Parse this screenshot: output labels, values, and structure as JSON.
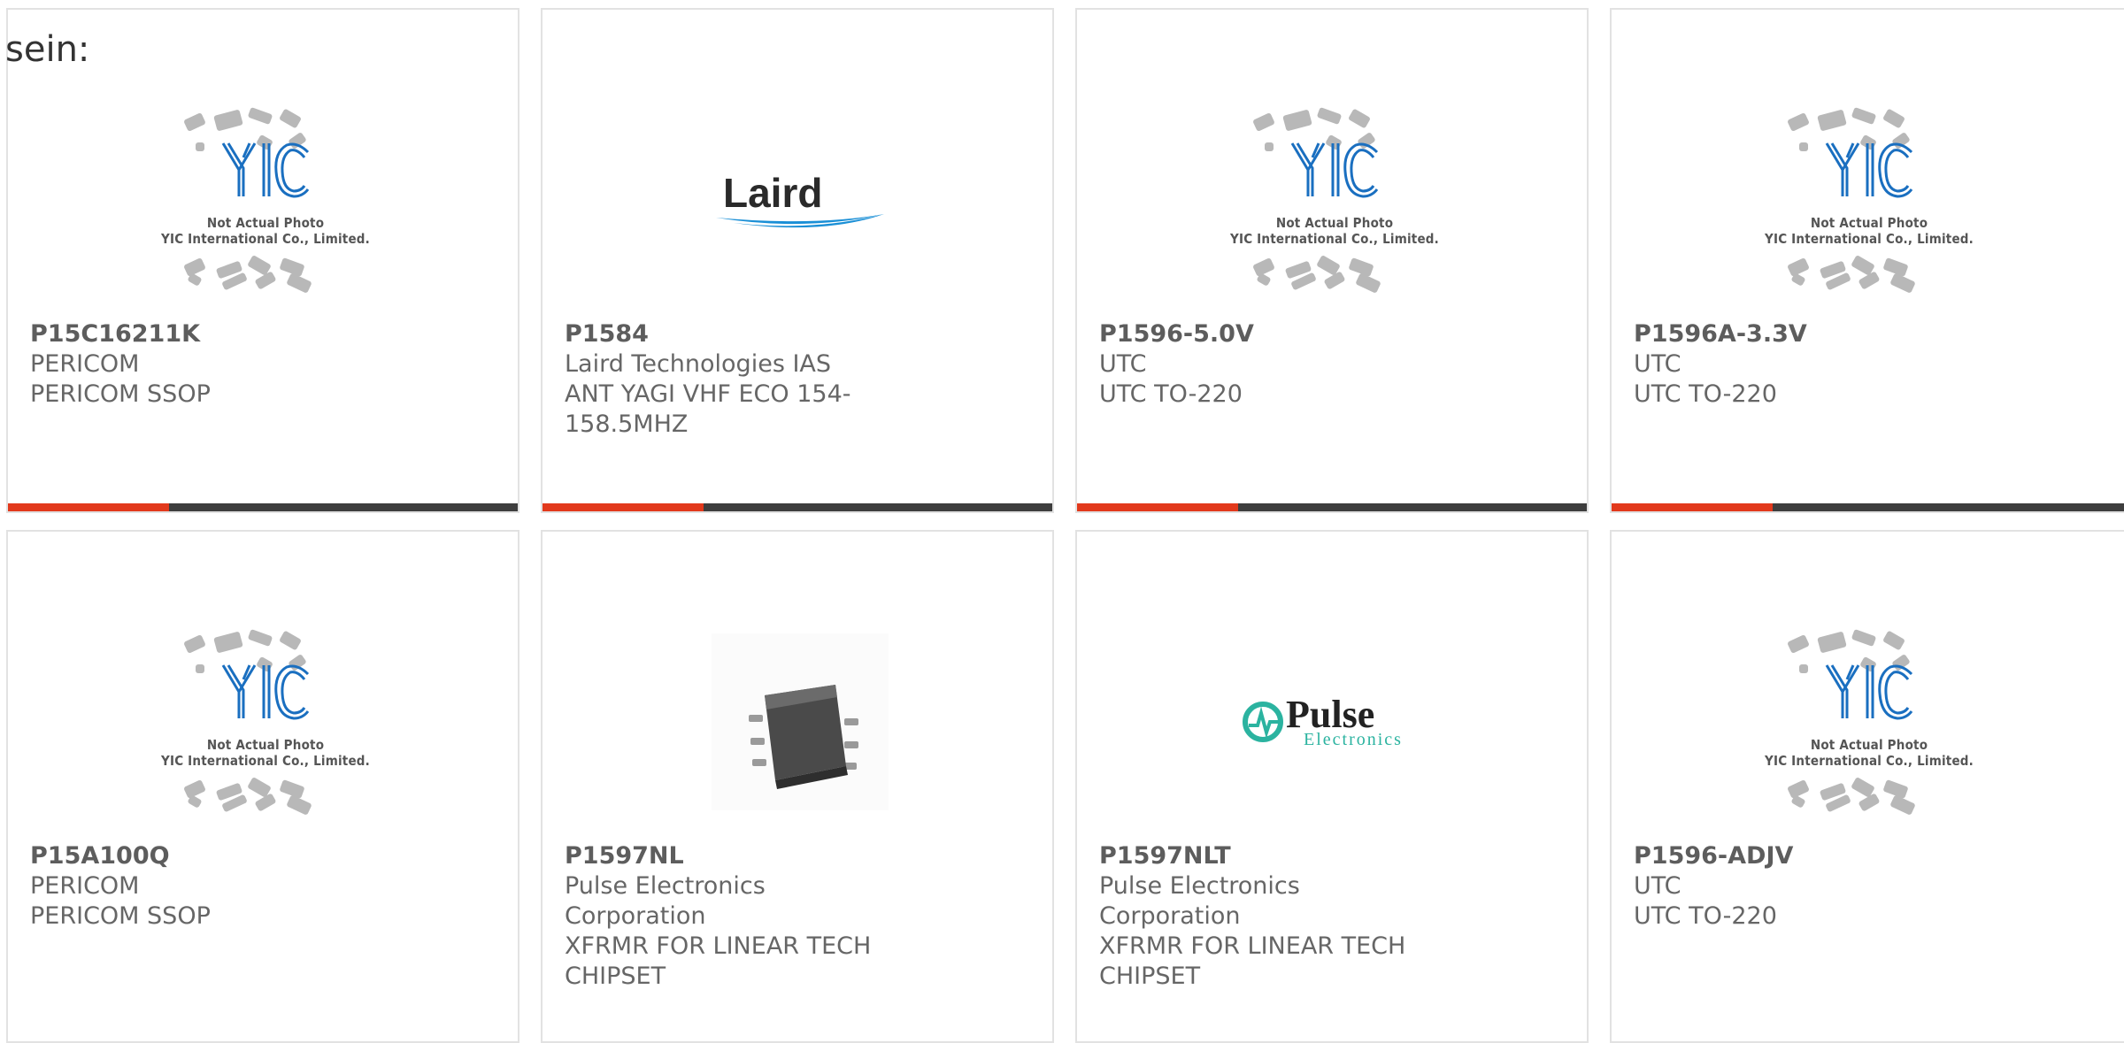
{
  "heading": "sein:",
  "yic_caption_line1": "Not Actual Photo",
  "yic_caption_line2": "YIC International Co., Limited.",
  "brand_logos": {
    "laird": "Laird",
    "pulse_word": "Pulse",
    "pulse_sub": "Electronics"
  },
  "colors": {
    "accent_red": "#e2391c",
    "bar_dark": "#3e3e3e",
    "card_border": "#e2e2e2",
    "yic_blue": "#1a6fc0",
    "laird_blue": "#1a8fd6",
    "pulse_teal": "#2bb3a0"
  },
  "products": [
    {
      "part": "P15C16211K",
      "manufacturer": "PERICOM",
      "description": "PERICOM SSOP",
      "image": "yic-placeholder"
    },
    {
      "part": "P1584",
      "manufacturer": "Laird Technologies IAS",
      "description": "ANT YAGI VHF ECO 154-158.5MHZ",
      "image": "laird-logo"
    },
    {
      "part": "P1596-5.0V",
      "manufacturer": "UTC",
      "description": "UTC TO-220",
      "image": "yic-placeholder"
    },
    {
      "part": "P1596A-3.3V",
      "manufacturer": "UTC",
      "description": "UTC TO-220",
      "image": "yic-placeholder"
    },
    {
      "part": "P15A100Q",
      "manufacturer": "PERICOM",
      "description": "PERICOM SSOP",
      "image": "yic-placeholder"
    },
    {
      "part": "P1597NL",
      "manufacturer": "Pulse Electronics Corporation",
      "description": "XFRMR FOR LINEAR TECH CHIPSET",
      "image": "transformer-photo"
    },
    {
      "part": "P1597NLT",
      "manufacturer": "Pulse Electronics Corporation",
      "description": "XFRMR FOR LINEAR TECH CHIPSET",
      "image": "pulse-logo"
    },
    {
      "part": "P1596-ADJV",
      "manufacturer": "UTC",
      "description": "UTC TO-220",
      "image": "yic-placeholder"
    }
  ]
}
